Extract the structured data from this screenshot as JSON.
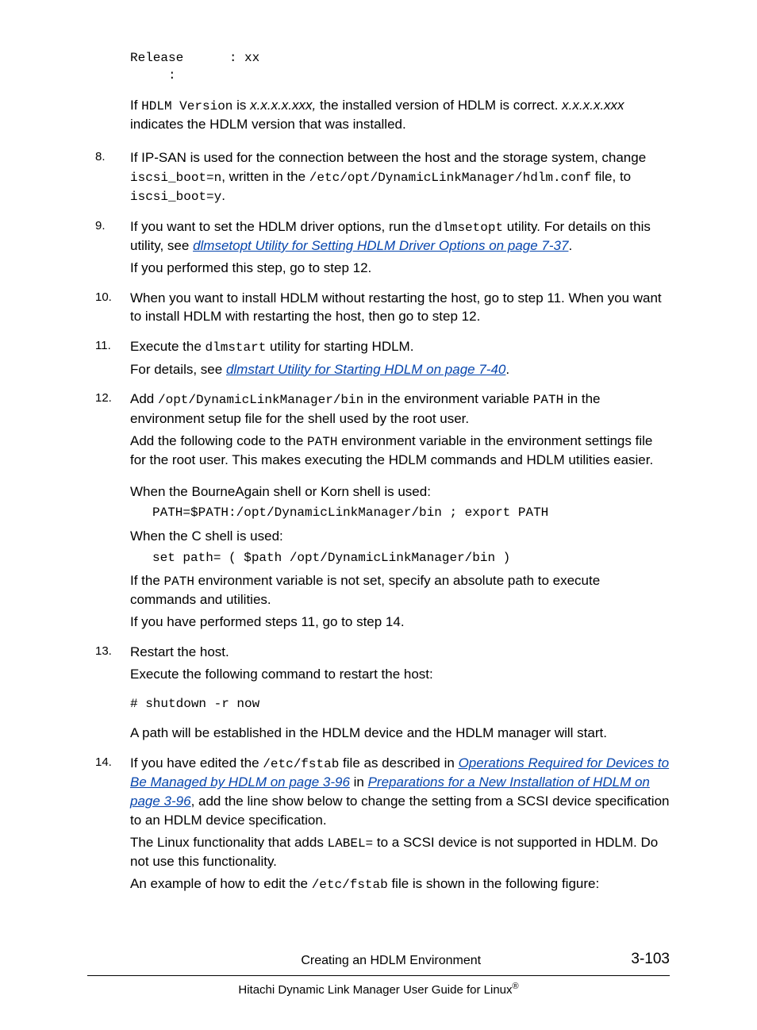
{
  "preamble": {
    "codeLine": "Release      : xx\n     :",
    "p1a": "If ",
    "p1code": "HDLM Version",
    "p1b": " is ",
    "p1i": "x.x.x.x.xxx,",
    "p1c": " the installed version of HDLM is correct. ",
    "p1i2": "x.x.x.x.xxx",
    "p1d": " indicates the HDLM version that was installed."
  },
  "items": {
    "n8": "8.",
    "i8a": "If IP-SAN is used for the connection between the host and the storage system, change ",
    "i8code1": "iscsi_boot=n",
    "i8b": ", written in the ",
    "i8code2": "/etc/opt/DynamicLinkManager/hdlm.conf",
    "i8c": " file, to ",
    "i8code3": "iscsi_boot=y",
    "i8d": ".",
    "n9": "9.",
    "i9a": "If you want to set the HDLM driver options, run the ",
    "i9code1": "dlmsetopt",
    "i9b": " utility. For details on this utility, see ",
    "i9link": "dlmsetopt Utility for Setting HDLM Driver Options on page 7-37",
    "i9c": ".",
    "i9p2": "If you performed this step, go to step 12.",
    "n10": "10.",
    "i10": "When you want to install HDLM without restarting the host, go to step 11. When you want to install HDLM with restarting the host, then go to step 12.",
    "n11": "11.",
    "i11a": "Execute the ",
    "i11code": "dlmstart",
    "i11b": " utility for starting HDLM.",
    "i11c": "For details, see ",
    "i11link": "dlmstart Utility for Starting HDLM on page 7-40",
    "i11d": ".",
    "n12": "12.",
    "i12a": "Add ",
    "i12code1": "/opt/DynamicLinkManager/bin",
    "i12b": " in the environment variable ",
    "i12code2": "PATH",
    "i12c": " in the environment setup file for the shell used by the root user.",
    "i12p2a": "Add the following code to the ",
    "i12p2code": "PATH",
    "i12p2b": " environment variable in the environment settings file for the root user. This makes executing the HDLM commands and HDLM utilities easier.",
    "i12p3": "When the BourneAgain shell or Korn shell is used:",
    "i12code3": "PATH=$PATH:/opt/DynamicLinkManager/bin ; export PATH",
    "i12p4": "When the C shell is used:",
    "i12code4": "set path= ( $path /opt/DynamicLinkManager/bin )",
    "i12p5a": "If the ",
    "i12p5code": "PATH",
    "i12p5b": " environment variable is not set, specify an absolute path to execute commands and utilities.",
    "i12p6": "If you have performed steps 11, go to step 14.",
    "n13": "13.",
    "i13a": "Restart the host.",
    "i13b": "Execute the following command to restart the host:",
    "i13code": "# shutdown -r now",
    "i13c": "A path will be established in the HDLM device and the HDLM manager will start.",
    "n14": "14.",
    "i14a": "If you have edited the ",
    "i14code1": "/etc/fstab",
    "i14b": " file as described in ",
    "i14link1": "Operations Required for Devices to Be Managed by HDLM on page 3-96",
    "i14c": " in ",
    "i14link2": "Preparations for a New Installation of HDLM on page 3-96",
    "i14d": ", add the line show below to change the setting from a SCSI device specification to an HDLM device specification.",
    "i14p2a": "The Linux functionality that adds ",
    "i14p2code": "LABEL=",
    "i14p2b": " to a SCSI device is not supported in HDLM. Do not use this functionality.",
    "i14p3a": "An example of how to edit the ",
    "i14p3code": "/etc/fstab",
    "i14p3b": " file is shown in the following figure:"
  },
  "footer": {
    "section": "Creating an HDLM Environment",
    "page": "3-103",
    "doc": "Hitachi Dynamic Link Manager User Guide for Linux"
  }
}
